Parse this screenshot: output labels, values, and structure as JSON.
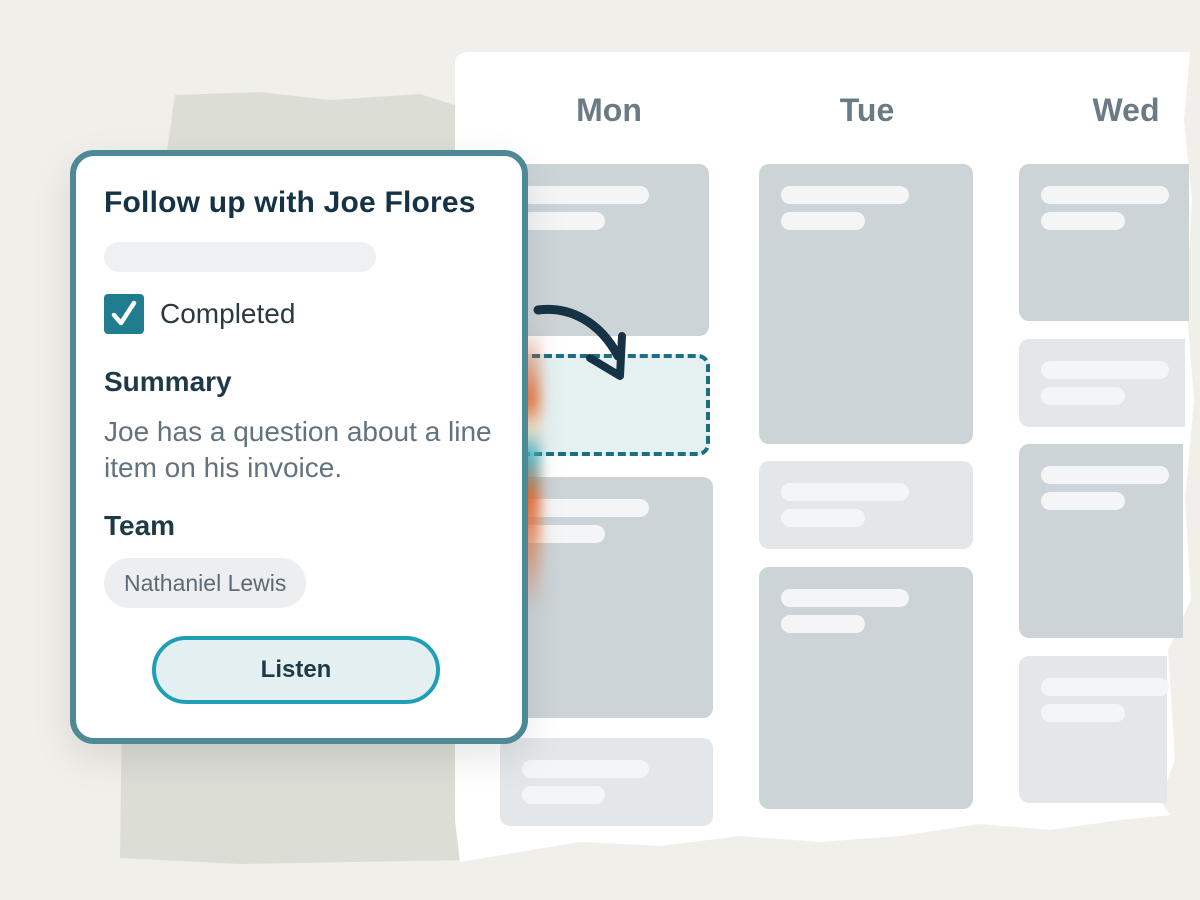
{
  "task": {
    "title": "Follow up with Joe Flores",
    "completed_label": "Completed",
    "completed": true,
    "summary_heading": "Summary",
    "summary": "Joe has a question about a line item on his invoice.",
    "team_heading": "Team",
    "team_members": [
      "Nathaniel Lewis"
    ],
    "listen_label": "Listen"
  },
  "calendar": {
    "days": [
      "Mon",
      "Tue",
      "Wed"
    ]
  },
  "colors": {
    "accent": "#1e9fb6",
    "card_border": "#4d8996",
    "checkbox": "#1f7d8f",
    "drop_target_border": "#1c6f80",
    "calendar_header": "#6a7b85"
  },
  "icons": {
    "checkbox": "checkmark-icon",
    "drag_arrow": "curved-arrow-icon"
  }
}
